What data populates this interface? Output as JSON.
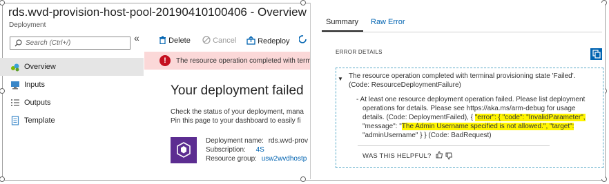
{
  "blade": {
    "title": "rds.wvd-provision-host-pool-20190410100406 - Overview",
    "subtitle": "Deployment"
  },
  "sidebar": {
    "search_placeholder": "Search (Ctrl+/)",
    "collapse": "«",
    "items": [
      {
        "label": "Overview",
        "icon": "overview-icon",
        "active": true
      },
      {
        "label": "Inputs",
        "icon": "inputs-icon"
      },
      {
        "label": "Outputs",
        "icon": "outputs-icon"
      },
      {
        "label": "Template",
        "icon": "template-icon"
      }
    ]
  },
  "toolbar": {
    "delete_label": "Delete",
    "cancel_label": "Cancel",
    "redeploy_label": "Redeploy"
  },
  "main": {
    "error_banner": "The resource operation completed with termi",
    "heading": "Your deployment failed",
    "line1": "Check the status of your deployment, mana",
    "line2": "Pin this page to your dashboard to easily fi",
    "deployment_name_label": "Deployment name:",
    "deployment_name_value": "rds.wvd-prov",
    "subscription_label": "Subscription:",
    "subscription_value": "4S",
    "resource_group_label": "Resource group:",
    "resource_group_value": "usw2wvdhostp"
  },
  "error_panel": {
    "tabs": [
      "Summary",
      "Raw Error"
    ],
    "details_heading": "ERROR DETAILS",
    "summary_line1": "The resource operation completed with terminal provisioning state 'Failed'.",
    "summary_line2": "(Code: ResourceDeploymentFailure)",
    "detail_lines": [
      "- At least one resource deployment operation failed. Please list deployment",
      "operations for details. Please see https://aka.ms/arm-debug for usage"
    ],
    "detail_l3_pre": "details. (Code: DeploymentFailed), { ",
    "detail_l3_hl": "\"error\": { \"code\": \"InvalidParameter\",",
    "detail_l4_pre": "\"message\": \"",
    "detail_l4_hl": "The Admin Username specified is not allowed.\", \"target\":",
    "detail_l5": "\"adminUsername\" } } (Code: BadRequest)",
    "helpful": "WAS THIS HELPFUL?"
  },
  "colors": {
    "accent": "#0063b1",
    "error": "#c50f1f",
    "error_banner_bg": "#fbd8d8",
    "highlight": "#fff500",
    "deployment_icon": "#5c2d91"
  }
}
